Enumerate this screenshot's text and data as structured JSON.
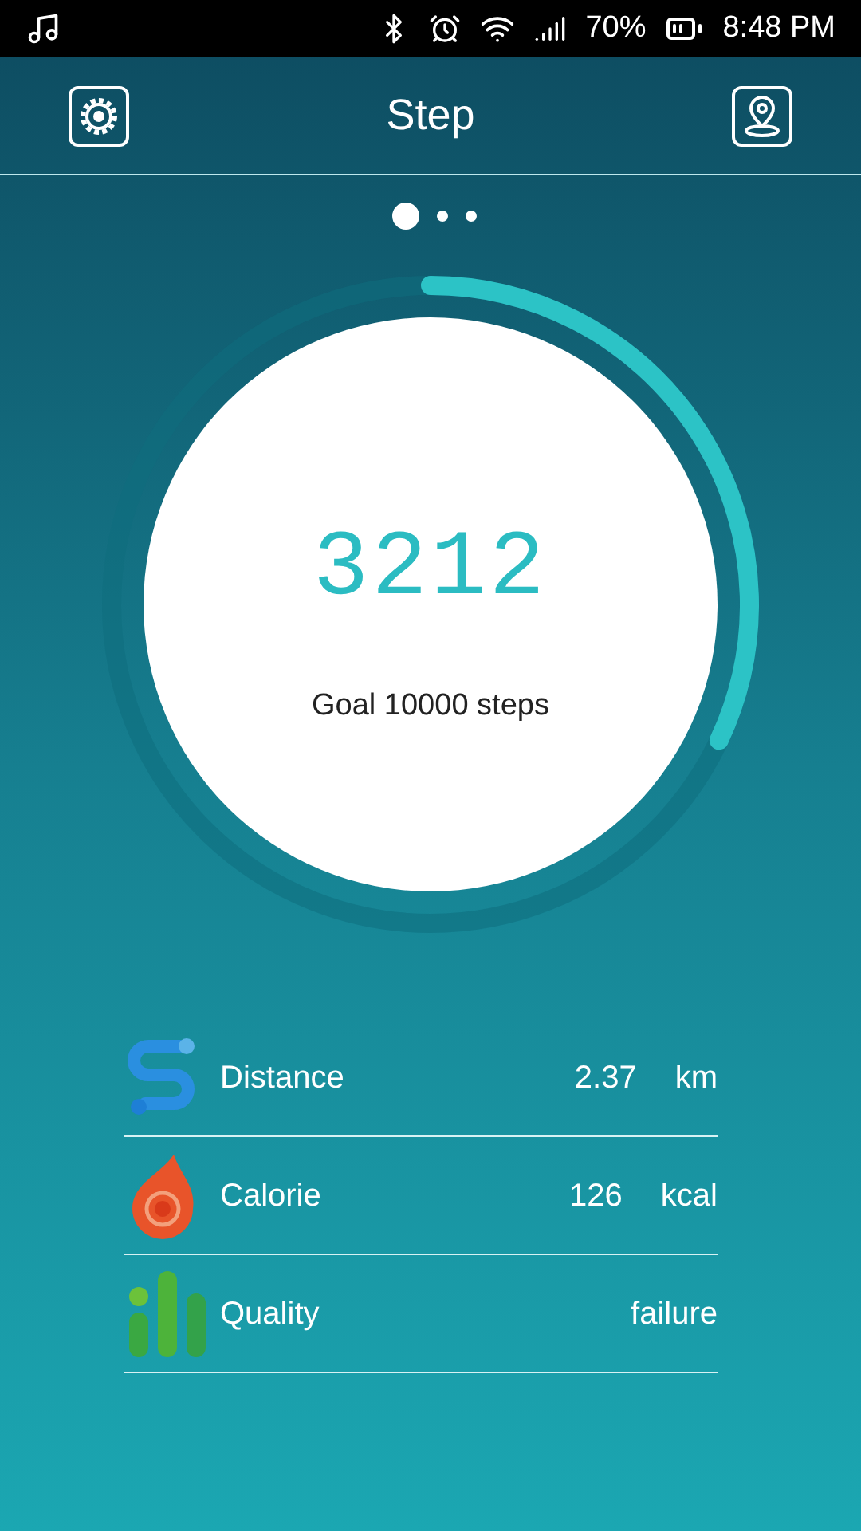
{
  "status_bar": {
    "battery": "70%",
    "time": "8:48 PM"
  },
  "header": {
    "title": "Step"
  },
  "pages": [
    {
      "selected": true
    },
    {
      "selected": false
    },
    {
      "selected": false
    }
  ],
  "progress": {
    "steps": "3212",
    "goal": "Goal 10000 steps"
  },
  "stats": [
    {
      "kind": "distance",
      "label": "Distance",
      "value": "2.37",
      "unit": "km"
    },
    {
      "kind": "calorie",
      "label": "Calorie",
      "value": "126",
      "unit": "kcal"
    },
    {
      "kind": "quality",
      "label": "Quality",
      "value": "failure"
    }
  ]
}
